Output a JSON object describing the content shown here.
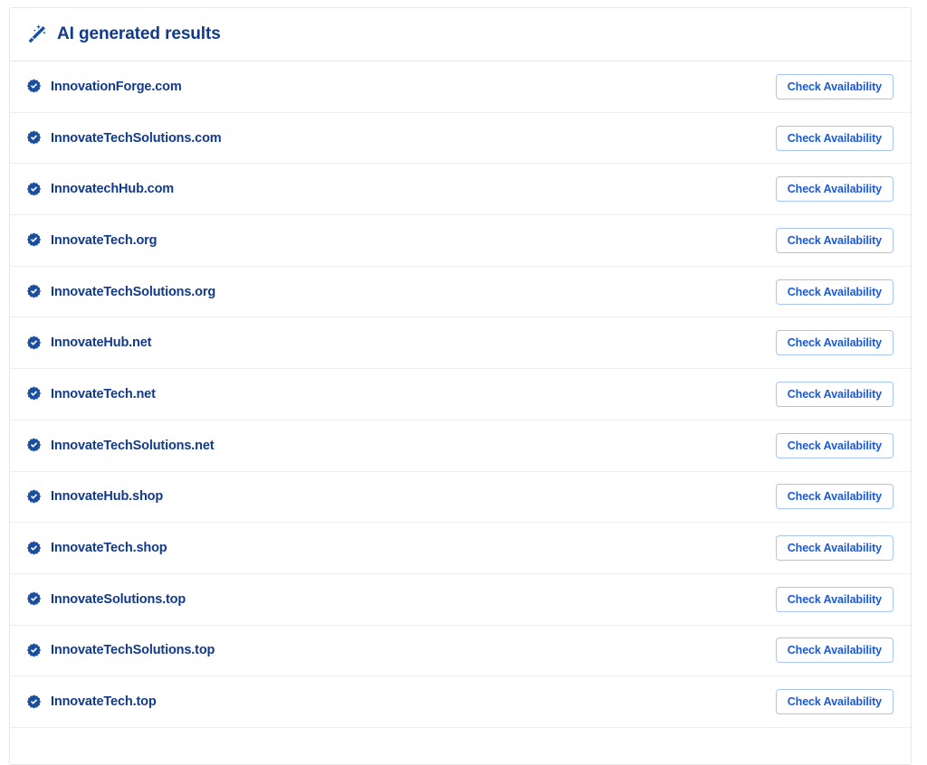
{
  "panel": {
    "header": {
      "icon": "magic-wand-icon",
      "title": "AI generated results"
    },
    "row_icon": "badge-check-icon",
    "action_label": "Check Availability",
    "results": [
      {
        "domain": "InnovationForge.com"
      },
      {
        "domain": "InnovateTechSolutions.com"
      },
      {
        "domain": "InnovatechHub.com"
      },
      {
        "domain": "InnovateTech.org"
      },
      {
        "domain": "InnovateTechSolutions.org"
      },
      {
        "domain": "InnovateHub.net"
      },
      {
        "domain": "InnovateTech.net"
      },
      {
        "domain": "InnovateTechSolutions.net"
      },
      {
        "domain": "InnovateHub.shop"
      },
      {
        "domain": "InnovateTech.shop"
      },
      {
        "domain": "InnovateSolutions.top"
      },
      {
        "domain": "InnovateTechSolutions.top"
      },
      {
        "domain": "InnovateTech.top"
      }
    ]
  },
  "colors": {
    "title_text": "#123a8a",
    "domain_text": "#123a8a",
    "button_text": "#1a5ad8",
    "button_border": "#a9c6f2",
    "badge_fill": "#1a4fa0",
    "divider": "#eceef2",
    "panel_border": "#e6e8ec",
    "background": "#ffffff"
  }
}
